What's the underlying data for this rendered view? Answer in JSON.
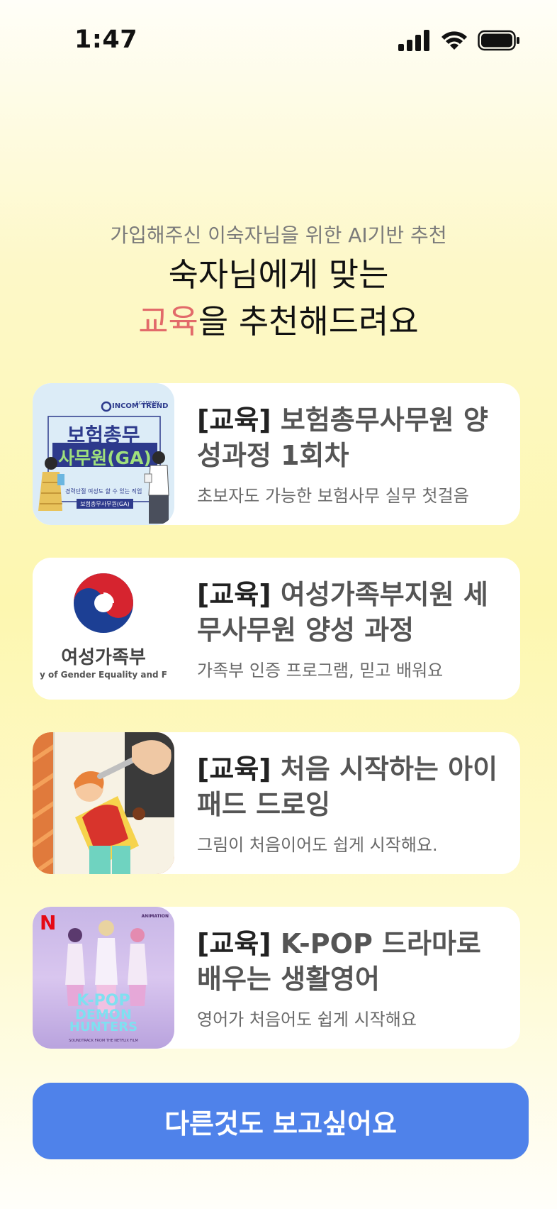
{
  "status": {
    "time": "1:47"
  },
  "intro": {
    "subtitle": "가입해주신 이숙자님을 위한 AI기반 추천",
    "headline_line1": "숙자님에게 맞는",
    "headline_accent": "교육",
    "headline_line2_rest": "을 추천해드려요"
  },
  "courses": [
    {
      "tag": "[교육]",
      "title_rest": " 보험총무사무원 양성과정 1회차",
      "desc": "초보자도 가능한 보험사무 실무 첫걸음",
      "thumb": {
        "brand": "INCOM TREND",
        "brand_top": "ACADEMY",
        "line1": "보험총무",
        "line2": "사무원(GA)",
        "caption": "경력단절 여성도 할 수 있는 직업",
        "badge": "보험총무사무원(GA)"
      }
    },
    {
      "tag": "[교육]",
      "title_rest": " 여성가족부지원 세무사무원 양성 과정",
      "desc": "가족부 인증 프로그램, 믿고 배워요",
      "thumb": {
        "org_name": "여성가족부",
        "org_english": "y of Gender Equality and F"
      }
    },
    {
      "tag": "[교육]",
      "title_rest": " 처음 시작하는 아이패드 드로잉",
      "desc": "그림이 처음이어도 쉽게 시작해요."
    },
    {
      "tag": "[교육]",
      "title_rest": " K-POP 드라마로 배우는 생활영어",
      "desc": "영어가 처음어도 쉽게 시작해요",
      "thumb": {
        "logo": "N",
        "top_label": "ANIMATION",
        "title_line1": "K-POP",
        "title_line2": "DEMON",
        "title_line3": "HUNTERS",
        "footer": "SOUNDTRACK FROM THE NETFLIX FILM"
      }
    }
  ],
  "cta": {
    "label": "다른것도 보고싶어요"
  },
  "colors": {
    "accent": "#e26a6a",
    "button": "#4f82ea",
    "card": "#ffffff"
  }
}
